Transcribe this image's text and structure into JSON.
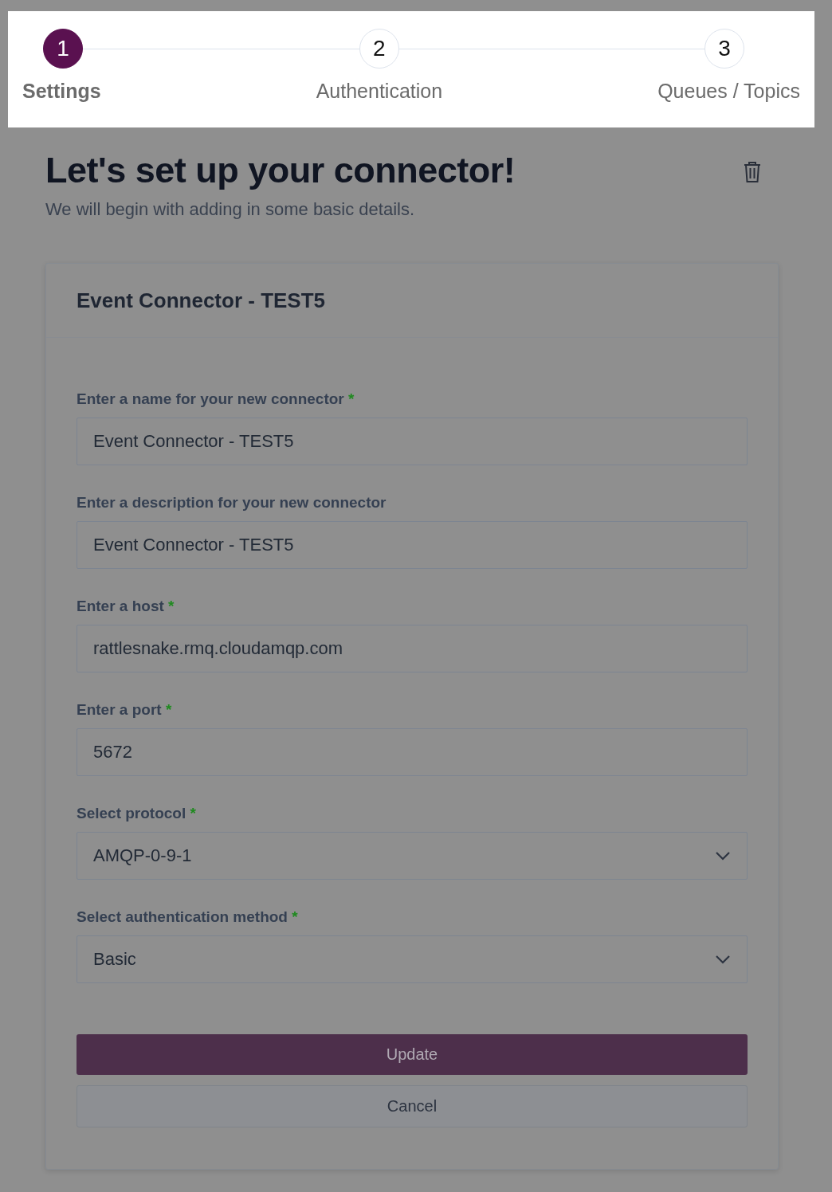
{
  "stepper": [
    {
      "number": "1",
      "label": "Settings",
      "selected": true
    },
    {
      "number": "2",
      "label": "Authentication",
      "selected": false
    },
    {
      "number": "3",
      "label": "Queues / Topics",
      "selected": false
    }
  ],
  "header": {
    "title": "Let's set up your connector!",
    "subtitle": "We will begin with adding in some basic details."
  },
  "card": {
    "title": "Event Connector - TEST5",
    "fields": [
      {
        "kind": "text",
        "label": "Enter a name for your new connector",
        "required_mark": "*",
        "value": "Event Connector - TEST5"
      },
      {
        "kind": "text",
        "label": "Enter a description for your new connector",
        "value": "Event Connector - TEST5"
      },
      {
        "kind": "text",
        "label": "Enter a host",
        "required_mark": "*",
        "value": "rattlesnake.rmq.cloudamqp.com"
      },
      {
        "kind": "text",
        "label": "Enter a port",
        "required_mark": "*",
        "value": "5672"
      },
      {
        "kind": "select",
        "label": "Select protocol",
        "required_mark": "*",
        "value": "AMQP-0-9-1"
      },
      {
        "kind": "select",
        "label": "Select authentication method",
        "required_mark": "*",
        "value": "Basic"
      }
    ],
    "buttons": [
      {
        "kind": "primary",
        "label": "Update"
      },
      {
        "kind": "secondary",
        "label": "Cancel"
      }
    ]
  }
}
